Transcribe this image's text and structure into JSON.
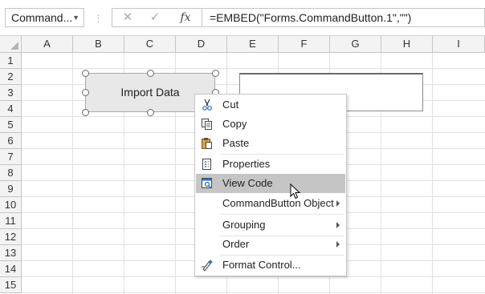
{
  "formula_bar": {
    "name_box": "Command...",
    "cancel_symbol": "✕",
    "enter_symbol": "✓",
    "fx_symbol": "fx",
    "formula": "=EMBED(\"Forms.CommandButton.1\",\"\")"
  },
  "columns": [
    "A",
    "B",
    "C",
    "D",
    "E",
    "F",
    "G",
    "H",
    "I"
  ],
  "rows": [
    "1",
    "2",
    "3",
    "4",
    "5",
    "6",
    "7",
    "8",
    "9",
    "10",
    "11",
    "12",
    "13",
    "14",
    "15"
  ],
  "command_button": {
    "label": "Import Data"
  },
  "context_menu": {
    "items": [
      {
        "label": "Cut",
        "icon": "scissors-icon"
      },
      {
        "label": "Copy",
        "icon": "copy-icon"
      },
      {
        "label": "Paste",
        "icon": "paste-icon"
      },
      {
        "label": "Properties",
        "icon": "properties-icon"
      },
      {
        "label": "View Code",
        "icon": "view-code-icon",
        "highlighted": true
      },
      {
        "label": "CommandButton Object",
        "submenu": true
      },
      {
        "label": "Grouping",
        "submenu": true
      },
      {
        "label": "Order",
        "submenu": true
      },
      {
        "label": "Format Control...",
        "icon": "format-control-icon"
      }
    ]
  },
  "colors": {
    "menu_highlight": "#c5c5c5",
    "header_bg": "#f3f3f3",
    "gridline": "#e1e1e1"
  }
}
